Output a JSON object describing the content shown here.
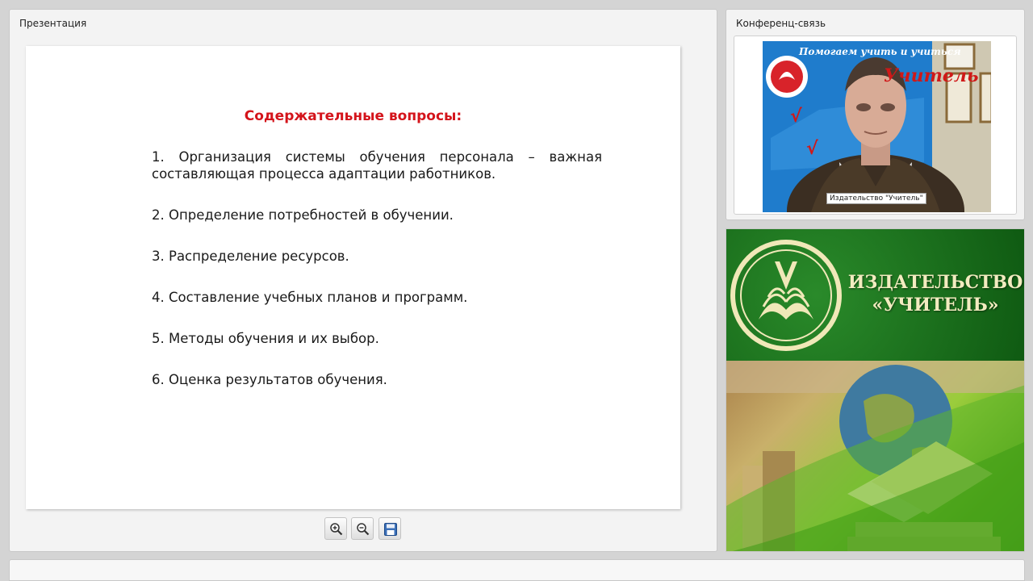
{
  "presentation": {
    "panel_title": "Презентация",
    "slide": {
      "heading": "Содержательные вопросы:",
      "items": [
        "1. Организация системы обучения персонала – важная составляющая процесса адаптации работников.",
        "2. Определение потребностей в обучении.",
        "3. Распределение ресурсов.",
        "4. Составление учебных планов и программ.",
        "5. Методы обучения и их выбор.",
        "6. Оценка результатов обучения."
      ]
    },
    "toolbar": {
      "zoom_in_icon": "zoom-in-icon",
      "zoom_out_icon": "zoom-out-icon",
      "save_icon": "save-icon"
    }
  },
  "conference": {
    "panel_title": "Конференц-связь",
    "video_caption": "Издательство \"Учитель\"",
    "poster_line1": "Помогаем учить и учиться",
    "poster_line2": "Учитель"
  },
  "brand": {
    "name_line1": "ИЗДАТЕЛЬСТВО",
    "name_line2": "«УЧИТЕЛЬ»"
  },
  "colors": {
    "heading_red": "#d4141b",
    "brand_green": "#1b6e1e",
    "brand_text": "#f3ecc0"
  }
}
